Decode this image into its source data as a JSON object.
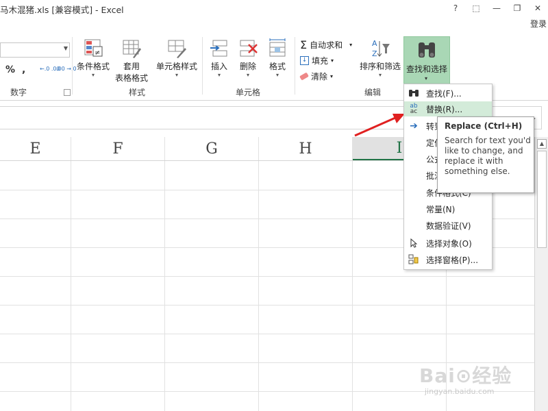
{
  "window": {
    "title": "马木混猪.xls  [兼容模式] - Excel",
    "controls": [
      "?",
      "⬚",
      "—",
      "❐",
      "✕"
    ],
    "login": "登录"
  },
  "ribbon": {
    "number_group": {
      "label": "数字",
      "percent": "%",
      "comma": ",",
      "inc_decimal": "←.0 .00",
      "dec_decimal": ".00 →.0"
    },
    "styles_group": {
      "label": "样式",
      "conditional_format": "条件格式",
      "table_format_line1": "套用",
      "table_format_line2": "表格格式",
      "cell_styles": "单元格样式"
    },
    "cells_group": {
      "label": "单元格",
      "insert": "插入",
      "delete": "删除",
      "format": "格式"
    },
    "edit_group": {
      "label": "编辑",
      "autosum": "自动求和",
      "fill": "填充",
      "clear": "清除",
      "sort_filter": "排序和筛选",
      "find_select": "查找和选择"
    }
  },
  "columns": [
    "E",
    "F",
    "G",
    "H",
    "I"
  ],
  "menu": {
    "items": [
      {
        "label": "查找(F)...",
        "icon": "binoculars-icon"
      },
      {
        "label": "替换(R)...",
        "icon": "replace-icon"
      },
      {
        "label": "转到",
        "icon": "goto-arrow-icon"
      },
      {
        "label": "定位",
        "icon": ""
      },
      {
        "label": "公式",
        "icon": ""
      },
      {
        "label": "批注",
        "icon": ""
      },
      {
        "label": "条件格式(C)",
        "icon": ""
      },
      {
        "label": "常量(N)",
        "icon": ""
      },
      {
        "label": "数据验证(V)",
        "icon": ""
      },
      {
        "label": "选择对象(O)",
        "icon": "cursor-icon"
      },
      {
        "label": "选择窗格(P)...",
        "icon": "selection-pane-icon"
      }
    ]
  },
  "tooltip": {
    "title": "Replace (Ctrl+H)",
    "body": "Search for text you'd like to change, and replace it with something else."
  },
  "watermark": {
    "brand": "Bai⊙经验",
    "url": "jingyan.baidu.com"
  },
  "colors": {
    "accent": "#217346",
    "highlight": "#a9d7b5",
    "menu_hover": "#d3ebd9",
    "arrow": "#e02020"
  }
}
